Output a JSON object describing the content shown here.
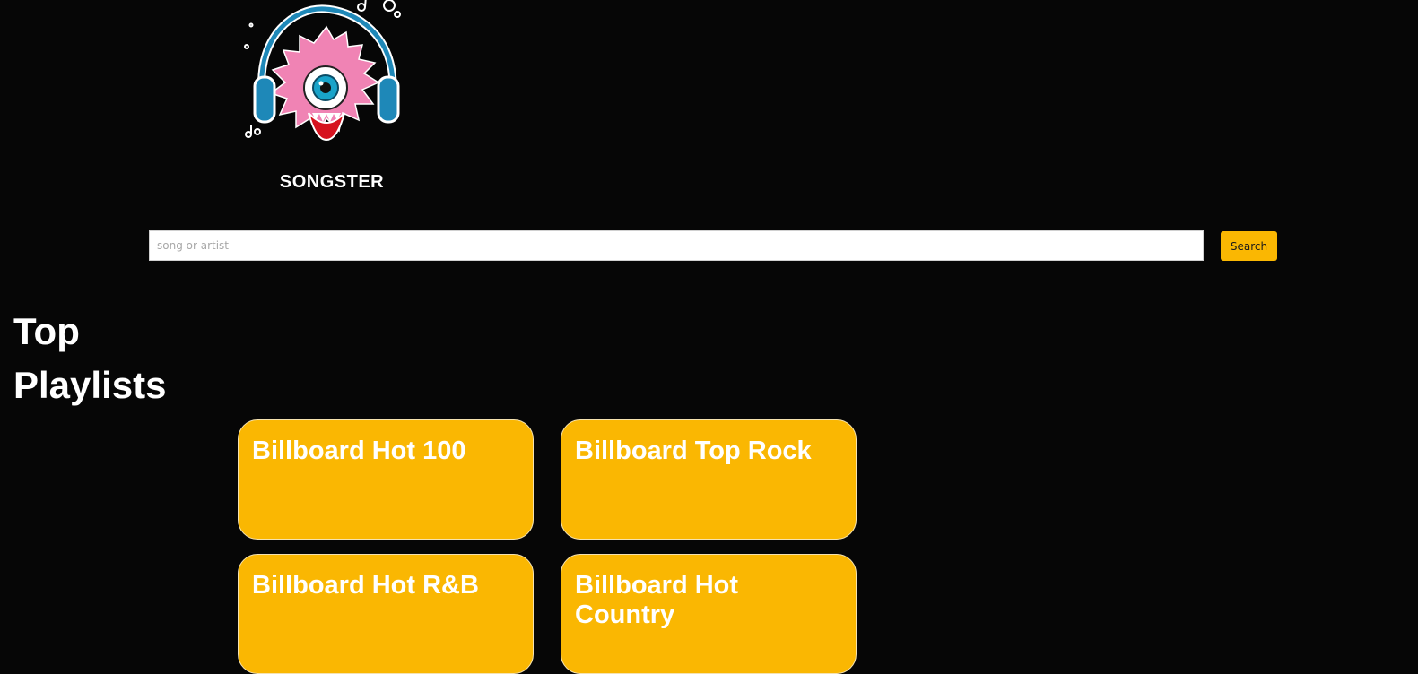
{
  "brand": {
    "name": "SONGSTER",
    "logo_icon": "fuzzy-monster-headphones-icon"
  },
  "search": {
    "placeholder": "song or artist",
    "value": "",
    "button_label": "Search"
  },
  "playlists": {
    "title": "Top Playlists",
    "items": [
      {
        "label": "Billboard Hot 100"
      },
      {
        "label": "Billboard Top Rock"
      },
      {
        "label": "Billboard Hot R&B"
      },
      {
        "label": "Billboard Hot Country"
      }
    ]
  },
  "colors": {
    "background": "#060606",
    "accent": "#fab702",
    "text": "#ffffff"
  }
}
